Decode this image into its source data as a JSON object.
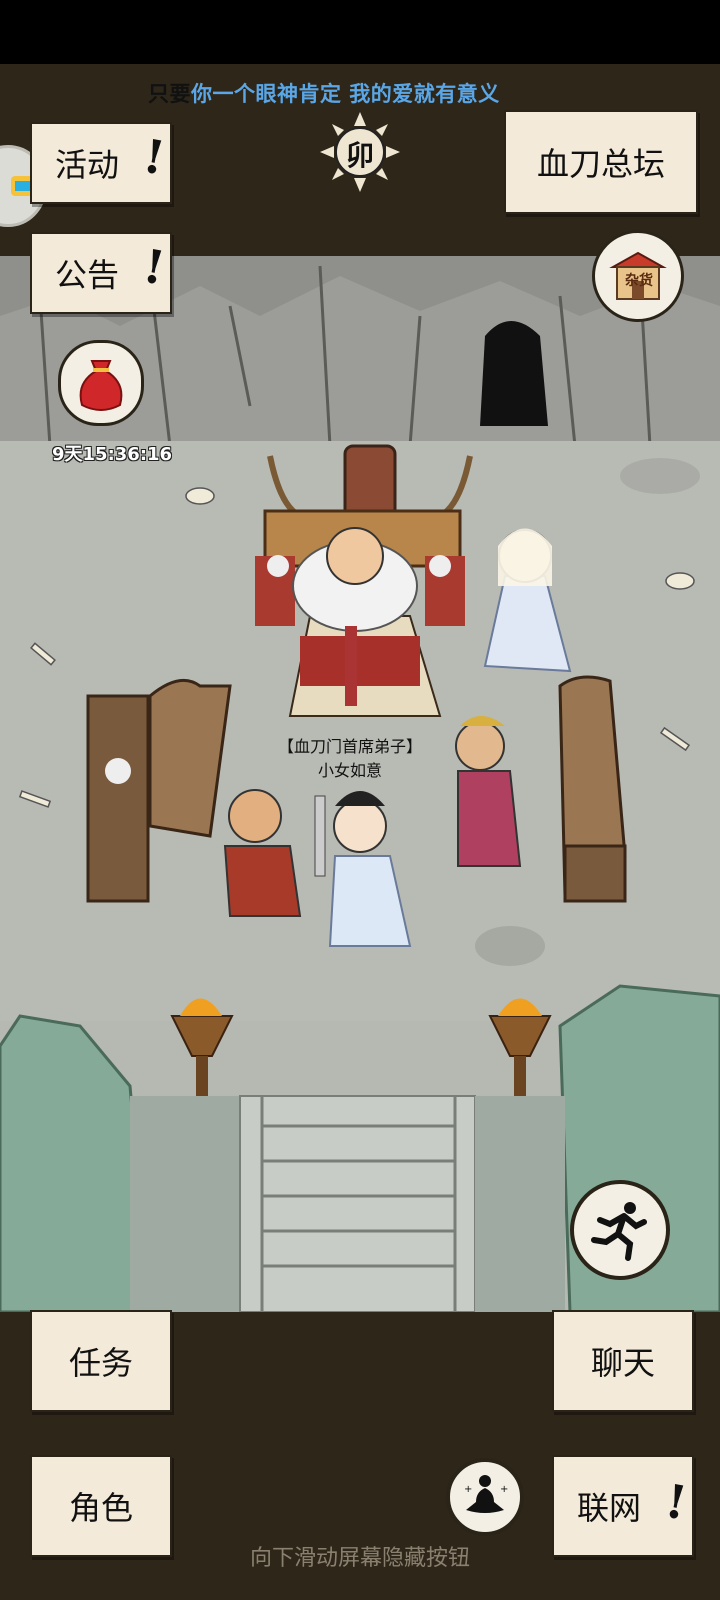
{
  "lyric": {
    "prefix": "只要",
    "rest": "你一个眼神肯定 我的爱就有意义"
  },
  "buttons": {
    "activity": "活动",
    "notice": "公告",
    "location": "血刀总坛",
    "task": "任务",
    "chat": "聊天",
    "role": "角色",
    "network": "联网"
  },
  "alert_mark": "!",
  "time_badge": {
    "char": "卯"
  },
  "shop": {
    "label": "杂货"
  },
  "event": {
    "countdown": "9天15:36:16"
  },
  "npc": {
    "title": "【血刀门首席弟子】",
    "name": "小女如意"
  },
  "hint": "向下滑动屏幕隐藏按钮",
  "colors": {
    "panel": "#f3ead9",
    "band": "#2e2619",
    "scene_floor": "#b6b8b2",
    "lyric": "#5aa6e6"
  }
}
